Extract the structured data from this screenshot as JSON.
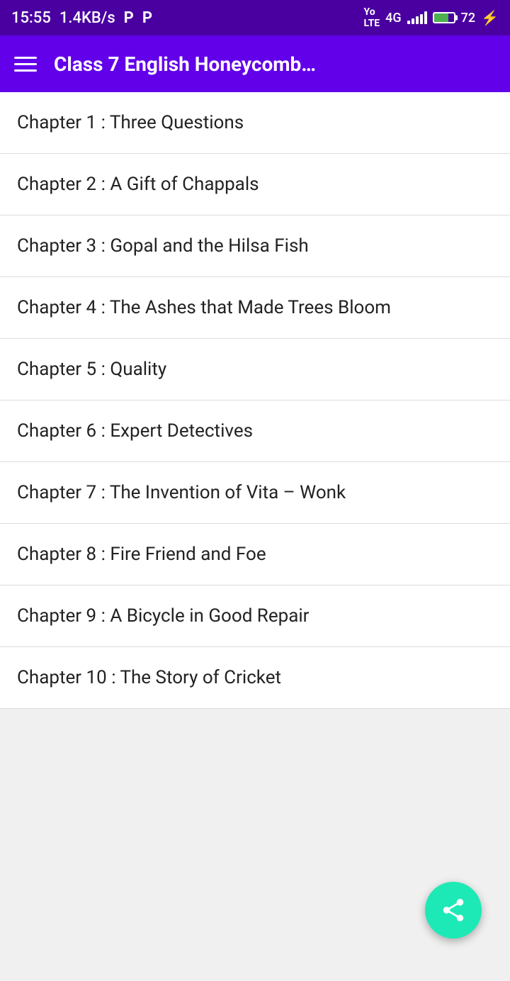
{
  "statusBar": {
    "time": "15:55",
    "network": "1.4KB/s",
    "p1": "P",
    "p2": "P",
    "battery": 72,
    "lte": "Yo LTE",
    "bars": "4G"
  },
  "appBar": {
    "title": "Class 7 English Honeycomb…"
  },
  "chapters": [
    {
      "label": "Chapter 1 : Three Questions"
    },
    {
      "label": "Chapter 2 : A Gift of Chappals"
    },
    {
      "label": "Chapter 3 : Gopal and the Hilsa Fish"
    },
    {
      "label": "Chapter 4 : The Ashes that Made Trees Bloom"
    },
    {
      "label": "Chapter 5 : Quality"
    },
    {
      "label": "Chapter 6 : Expert Detectives"
    },
    {
      "label": "Chapter 7 : The Invention of Vita – Wonk"
    },
    {
      "label": "Chapter 8 : Fire Friend and Foe"
    },
    {
      "label": "Chapter 9 : A Bicycle in Good Repair"
    },
    {
      "label": "Chapter 10 : The Story of Cricket"
    }
  ],
  "fab": {
    "icon": "share-icon"
  }
}
